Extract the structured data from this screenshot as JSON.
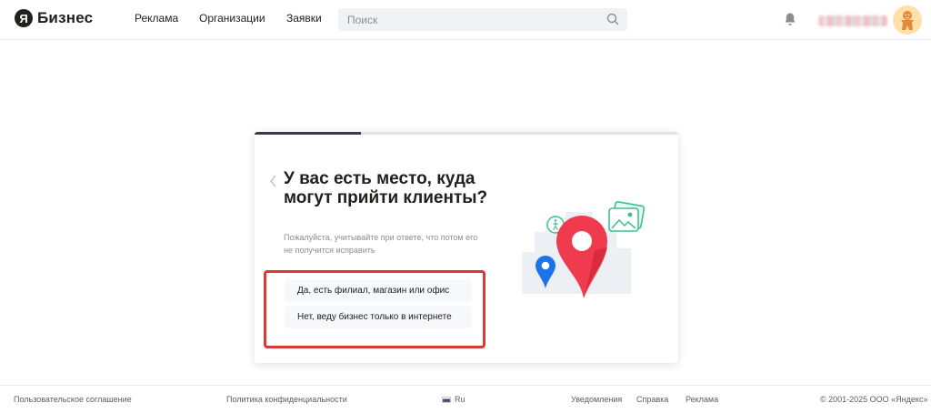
{
  "header": {
    "logo_letter": "Я",
    "logo_text": "Бизнес",
    "nav": [
      "Реклама",
      "Организации",
      "Заявки"
    ],
    "search_placeholder": "Поиск"
  },
  "onboarding": {
    "progress_fraction": 0.25,
    "title": "У вас есть место, куда могут прийти клиенты?",
    "subtitle": "Пожалуйста, учитывайте при ответе, что потом его не получится исправить",
    "options": [
      "Да, есть филиал, магазин или офис",
      "Нет, веду бизнес только в интернете"
    ]
  },
  "footer": {
    "terms": "Пользовательское соглашение",
    "privacy": "Политика конфиденциальности",
    "language": "Ru",
    "notifications": "Уведомления",
    "help": "Справка",
    "ads": "Реклама",
    "copyright": "© 2001-2025 ООО «Яндекс»"
  },
  "colors": {
    "progress": "#393a52",
    "highlight": "#d93a36",
    "pin_red": "#f03a4e",
    "pin_blue": "#1a73e8",
    "accent_green": "#3fbf8f"
  }
}
